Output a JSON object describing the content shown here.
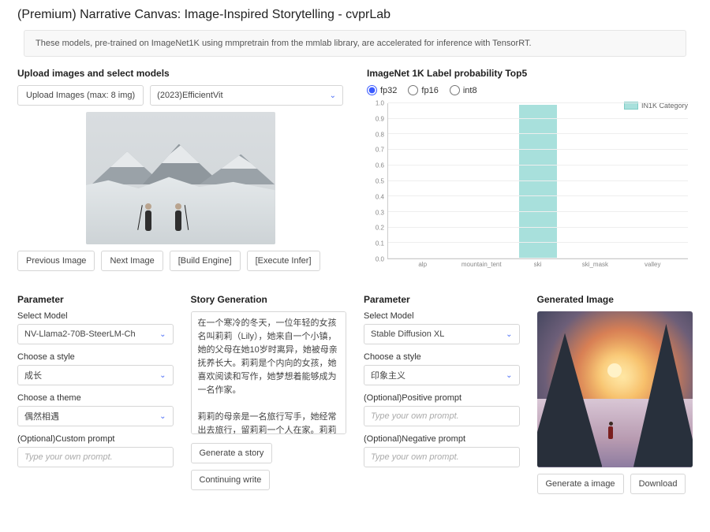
{
  "title": "(Premium) Narrative Canvas: Image-Inspired Storytelling - cvprLab",
  "banner": "These models, pre-trained on ImageNet1K using mmpretrain from the mmlab library, are accelerated for inference with TensorRT.",
  "upload": {
    "section_title": "Upload images and select models",
    "upload_btn": "Upload Images (max: 8 img)",
    "model_select": "(2023)EfficientVit",
    "prev_btn": "Previous Image",
    "next_btn": "Next Image",
    "build_btn": "[Build Engine]",
    "infer_btn": "[Execute Infer]"
  },
  "probs": {
    "section_title": "ImageNet 1K Label probability Top5",
    "precisions": [
      "fp32",
      "fp16",
      "int8"
    ],
    "selected_precision": "fp32",
    "legend": "IN1K Category"
  },
  "chart_data": {
    "type": "bar",
    "title": "",
    "xlabel": "",
    "ylabel": "",
    "ylim": [
      0,
      1.0
    ],
    "yticks": [
      0,
      0.1,
      0.2,
      0.3,
      0.4,
      0.5,
      0.6,
      0.7,
      0.8,
      0.9,
      1.0
    ],
    "categories": [
      "alp",
      "mountain_tent",
      "ski",
      "ski_mask",
      "valley"
    ],
    "values": [
      0.0,
      0.0,
      0.99,
      0.005,
      0.005
    ],
    "series_name": "IN1K Category",
    "color": "#a8e0dc"
  },
  "param_left": {
    "section_title": "Parameter",
    "select_model_label": "Select Model",
    "select_model_value": "NV-Llama2-70B-SteerLM-Ch",
    "style_label": "Choose a style",
    "style_value": "成长",
    "theme_label": "Choose a theme",
    "theme_value": "偶然相遇",
    "custom_label": "(Optional)Custom prompt",
    "custom_placeholder": "Type your own prompt."
  },
  "story": {
    "section_title": "Story Generation",
    "text": "在一个寒冷的冬天，一位年轻的女孩名叫莉莉（Lily），她来自一个小镇，她的父母在她10岁时离异，她被母亲抚养长大。莉莉是个内向的女孩，她喜欢阅读和写作，她梦想着能够成为一名作家。\n\n莉莉的母亲是一名旅行写手，她经常出去旅行，留莉莉一个人在家。莉莉感觉自己很孤独，她想要找到一个能够让她感觉到归属感和安全感的地方。",
    "generate_btn": "Generate a story",
    "continue_btn": "Continuing write"
  },
  "param_right": {
    "section_title": "Parameter",
    "select_model_label": "Select Model",
    "select_model_value": "Stable Diffusion XL",
    "style_label": "Choose a style",
    "style_value": "印象主义",
    "pos_label": "(Optional)Positive prompt",
    "pos_placeholder": "Type your own prompt.",
    "neg_label": "(Optional)Negative prompt",
    "neg_placeholder": "Type your own prompt."
  },
  "genimg": {
    "section_title": "Generated Image",
    "generate_btn": "Generate a image",
    "download_btn": "Download"
  }
}
